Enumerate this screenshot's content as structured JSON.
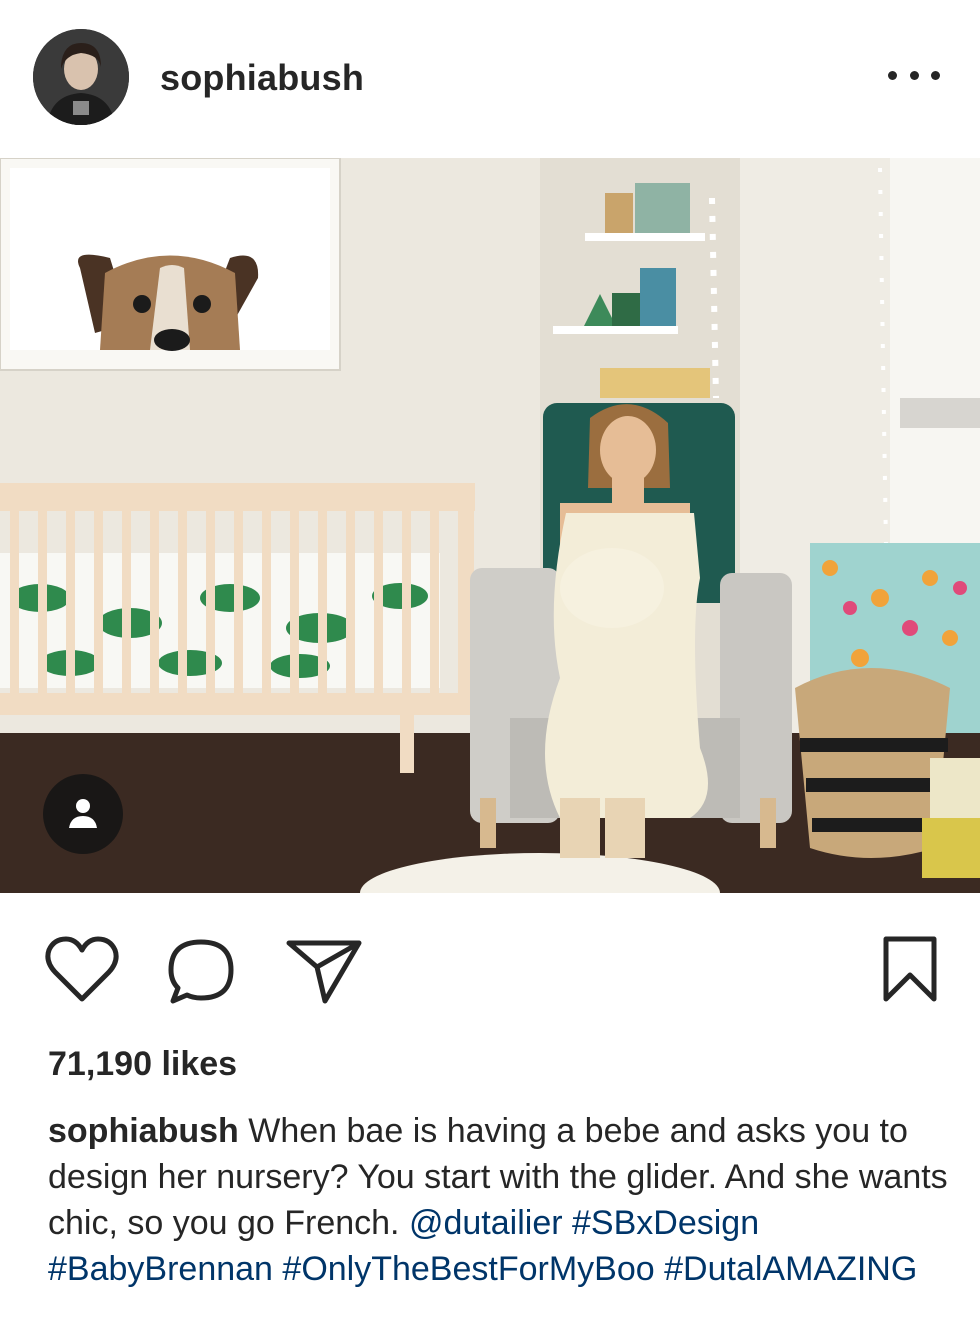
{
  "post": {
    "username": "sophiabush",
    "more_icon": "more-horizontal-icon",
    "avatar_icon": "profile-avatar",
    "photo_description_icon": "post-photo",
    "tag_icon": "user-tag-icon",
    "actions": {
      "like_icon": "heart-icon",
      "comment_icon": "comment-bubble-icon",
      "share_icon": "paper-plane-icon",
      "save_icon": "bookmark-icon"
    },
    "likes": "71,190 likes",
    "caption": {
      "username": "sophiabush",
      "text": "When bae is having a bebe and asks you to design her nursery? You start with the glider. And she wants chic, so you go French.",
      "mention": "@dutailier",
      "hashtags": [
        "#SBxDesign",
        "#BabyBrennan",
        "#OnlyTheBestForMyBoo",
        "#DutalAMAZING"
      ]
    },
    "colors": {
      "text": "#262626",
      "link": "#003569",
      "background": "#ffffff"
    }
  }
}
